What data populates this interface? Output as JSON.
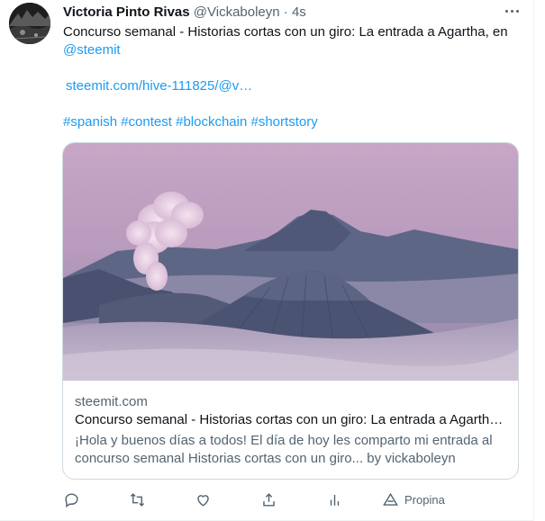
{
  "tweet": {
    "author_name": "Victoria Pinto Rivas",
    "handle": "@Vickaboleyn",
    "separator": "·",
    "time": "4s",
    "text_line1": "Concurso semanal - Historias cortas con un giro: La entrada a Agartha, en",
    "mention": "@steemit",
    "url": "steemit.com/hive-111825/@v…",
    "hashtags": [
      "#spanish",
      "#contest",
      "#blockchain",
      "#shortstory"
    ]
  },
  "card": {
    "domain": "steemit.com",
    "title": "Concurso semanal - Historias cortas con un giro: La entrada a Agarth…",
    "description": "¡Hola y buenos días a todos! El día de hoy les comparto mi entrada al concurso semanal Historias cortas con un giro... by vickaboleyn"
  },
  "actions": {
    "tip_label": "Propina"
  },
  "icons": [
    "more-icon",
    "reply-icon",
    "retweet-icon",
    "like-icon",
    "share-icon",
    "analytics-icon",
    "tip-icon"
  ],
  "colors": {
    "link": "#1d9bf0",
    "secondary_text": "#536471",
    "primary_text": "#0f1419",
    "border": "#cfd9de"
  }
}
